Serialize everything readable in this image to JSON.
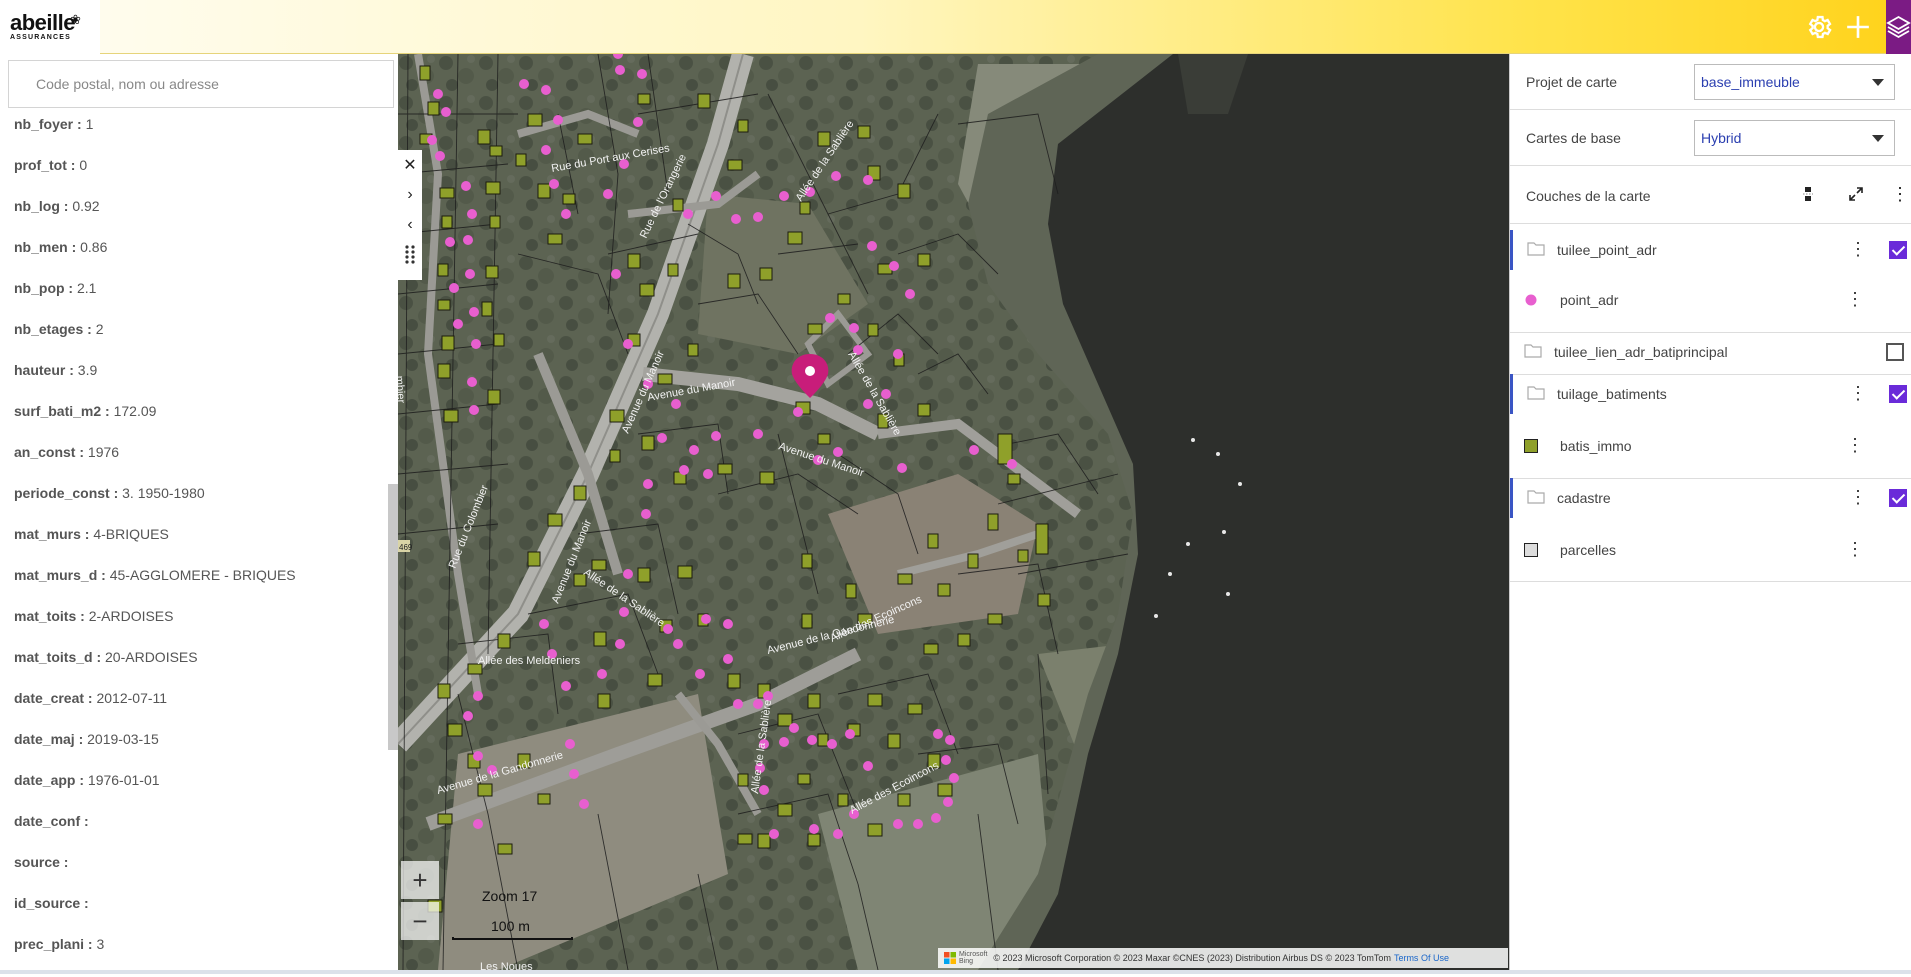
{
  "brand": {
    "name": "abeille",
    "tagline": "ASSURANCES"
  },
  "topbar": {
    "settings_icon": "gear-icon",
    "add_icon": "plus-icon",
    "layers_icon": "layers-icon",
    "accent_color": "#7b1b84"
  },
  "search": {
    "placeholder": "Code postal, nom ou adresse",
    "value": ""
  },
  "attributes": [
    {
      "key": "nb_foyer :",
      "value": "1"
    },
    {
      "key": "prof_tot :",
      "value": "0"
    },
    {
      "key": "nb_log :",
      "value": "0.92"
    },
    {
      "key": "nb_men :",
      "value": "0.86"
    },
    {
      "key": "nb_pop :",
      "value": "2.1"
    },
    {
      "key": "nb_etages :",
      "value": "2"
    },
    {
      "key": "hauteur :",
      "value": "3.9"
    },
    {
      "key": "surf_bati_m2 :",
      "value": "172.09"
    },
    {
      "key": "an_const :",
      "value": "1976"
    },
    {
      "key": "periode_const :",
      "value": "3. 1950-1980"
    },
    {
      "key": "mat_murs :",
      "value": "4-BRIQUES"
    },
    {
      "key": "mat_murs_d :",
      "value": "45-AGGLOMERE - BRIQUES"
    },
    {
      "key": "mat_toits :",
      "value": "2-ARDOISES"
    },
    {
      "key": "mat_toits_d :",
      "value": "20-ARDOISES"
    },
    {
      "key": "date_creat :",
      "value": "2012-07-11"
    },
    {
      "key": "date_maj :",
      "value": "2019-03-15"
    },
    {
      "key": "date_app :",
      "value": "1976-01-01"
    },
    {
      "key": "date_conf :",
      "value": ""
    },
    {
      "key": "source :",
      "value": ""
    },
    {
      "key": "id_source :",
      "value": ""
    },
    {
      "key": "prec_plani :",
      "value": "3"
    }
  ],
  "map": {
    "zoom_label": "Zoom 17",
    "scale_label": "100 m",
    "zoom_in": "+",
    "zoom_out": "−",
    "attribution": "© 2023 Microsoft Corporation © 2023 Maxar ©CNES (2023) Distribution Airbus DS © 2023 TomTom",
    "terms": "Terms Of Use",
    "bing_label_1": "Microsoft",
    "bing_label_2": "Bing",
    "street_labels": [
      "Rue du Port aux Cerises",
      "Rue de l'Orangerie",
      "Rue du Colombier",
      "Avenue du Manoir",
      "Avenue du Manoir",
      "Avenue de la Gandonnerie",
      "Allée de la Sablière",
      "Allée des Meldeniers",
      "Avenue de la Gandonnerie",
      "Allée des Ecoincons",
      "Allée des Ecoincons",
      "Les Noues",
      "mbier",
      "469"
    ],
    "colors": {
      "building": "#8fa02a",
      "point": "#e85fcf",
      "marker": "#c81d7a",
      "water": "#2d2f2c"
    }
  },
  "side_tools": {
    "close": "close-icon",
    "next": "chevron-right-icon",
    "prev": "chevron-left-icon",
    "drag": "drag-handle-icon"
  },
  "right": {
    "projet_label": "Projet de carte",
    "projet_value": "base_immeuble",
    "base_label": "Cartes de base",
    "base_value": "Hybrid",
    "layers_title": "Couches de la carte",
    "layers": [
      {
        "name": "tuilee_point_adr",
        "type": "group",
        "checked": true
      },
      {
        "name": "point_adr",
        "type": "point",
        "color": "#e85fcf"
      },
      {
        "name": "tuilee_lien_adr_batiprincipal",
        "type": "group",
        "checked": false
      },
      {
        "name": "tuilage_batiments",
        "type": "group",
        "checked": true
      },
      {
        "name": "batis_immo",
        "type": "fill",
        "color": "#8fa02a"
      },
      {
        "name": "cadastre",
        "type": "group",
        "checked": true
      },
      {
        "name": "parcelles",
        "type": "fill",
        "color": "#dddddd"
      }
    ]
  }
}
